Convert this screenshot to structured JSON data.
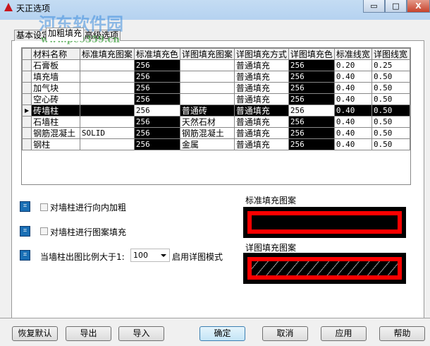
{
  "window": {
    "title": "天正选项",
    "controls": {
      "minimize": "▭",
      "maximize": "□",
      "close": "X"
    }
  },
  "watermark": {
    "name": "河东软件园",
    "url": "www.pc0359.cn"
  },
  "tabs": [
    {
      "label": "基本设定"
    },
    {
      "label": "加粗填充"
    },
    {
      "label": "高级选项"
    }
  ],
  "grid": {
    "columns": [
      "材料名称",
      "标准填充图案",
      "标准填充色",
      "详图填充图案",
      "详图填充方式",
      "详图填充色",
      "标准线宽",
      "详图线宽"
    ],
    "rows": [
      [
        "石膏板",
        "",
        "256",
        "",
        "普通填充",
        "256",
        "0.20",
        "0.25"
      ],
      [
        "填充墙",
        "",
        "256",
        "",
        "普通填充",
        "256",
        "0.40",
        "0.50"
      ],
      [
        "加气块",
        "",
        "256",
        "",
        "普通填充",
        "256",
        "0.40",
        "0.50"
      ],
      [
        "空心砖",
        "",
        "256",
        "",
        "普通填充",
        "256",
        "0.40",
        "0.50"
      ],
      [
        "砖墙柱",
        "",
        "256",
        "普通砖",
        "普通填充",
        "256",
        "0.40",
        "0.50"
      ],
      [
        "石墙柱",
        "",
        "256",
        "天然石材",
        "普通填充",
        "256",
        "0.40",
        "0.50"
      ],
      [
        "钢筋混凝土",
        "SOLID",
        "256",
        "钢筋混凝土",
        "普通填充",
        "256",
        "0.40",
        "0.50"
      ],
      [
        "钢柱",
        "",
        "256",
        "金属",
        "普通填充",
        "256",
        "0.40",
        "0.50"
      ]
    ],
    "selected_row": 4
  },
  "options": {
    "inward_bold": {
      "label": "对墙柱进行向内加粗",
      "checked": false
    },
    "pattern_fill": {
      "label": "对墙柱进行图案填充",
      "checked": false
    },
    "scale_label": "当墙柱出图比例大于1:",
    "scale_value": "100",
    "scale_suffix": "启用详图模式"
  },
  "previews": {
    "standard_label": "标准填充图案",
    "detail_label": "详图填充图案"
  },
  "buttons": {
    "restore": "恢复默认",
    "export": "导出",
    "import": "导入",
    "ok": "确定",
    "cancel": "取消",
    "apply": "应用",
    "help": "帮助"
  }
}
